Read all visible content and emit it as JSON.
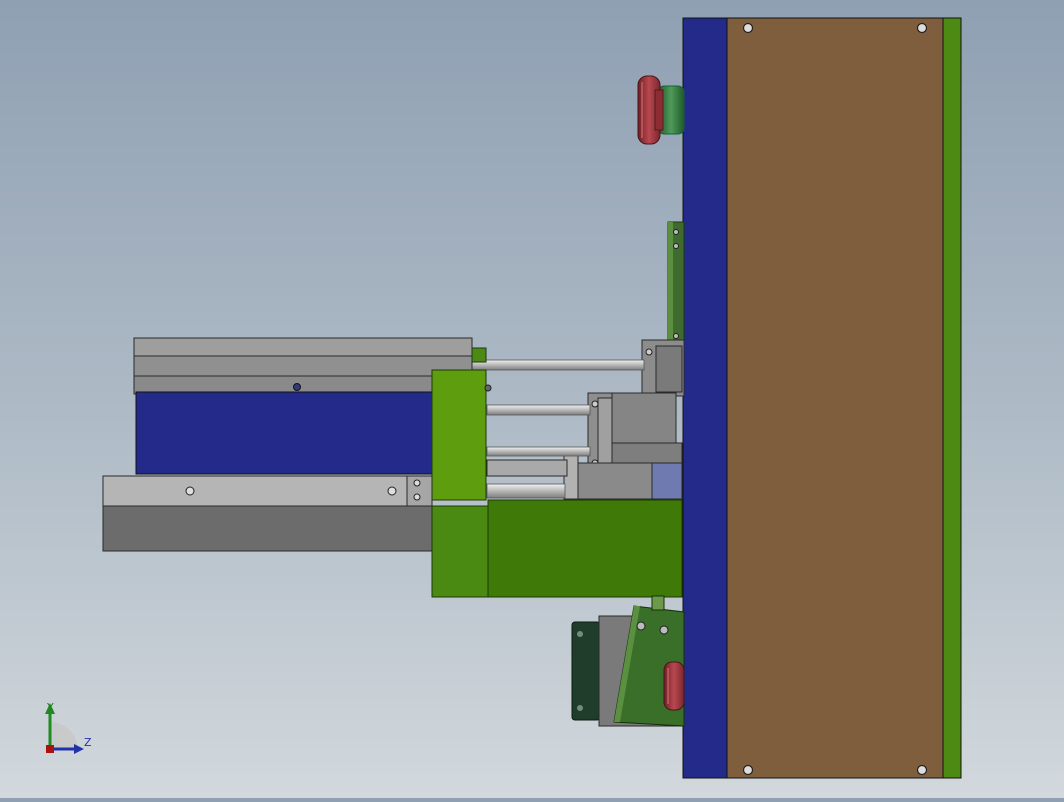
{
  "viewport": {
    "background_top": "#8fa0b3",
    "background_bottom": "#d2d8dc"
  },
  "palette": {
    "plate_blue": "#232a8a",
    "plate_brown": "#7f5e3e",
    "plate_green": "#4d8a14",
    "light_green": "#5d9d0e",
    "dark_green": "#3f7a08",
    "steel_gray": "#9a9a9a",
    "dark_gray": "#6c6c6c",
    "button_red": "#a7373f",
    "button_green": "#2f7a3a"
  },
  "icons": {
    "coordinate_triad": "axis-triad-icon",
    "emergency_stop": "mushroom-button-icon",
    "screw_hole": "screw-hole-icon"
  },
  "triad": {
    "y_label": "Y",
    "z_label": "Z"
  }
}
